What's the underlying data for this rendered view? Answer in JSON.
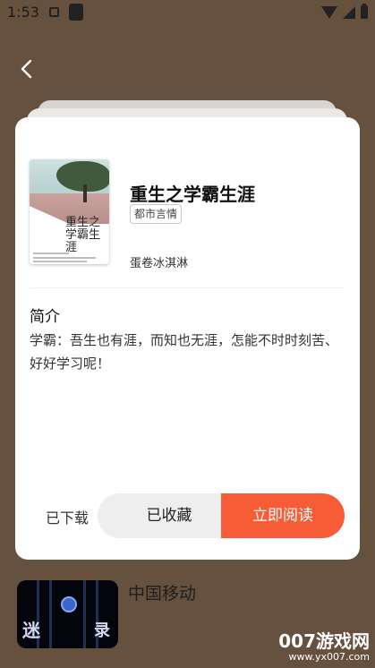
{
  "status_bar": {
    "time": "1:53"
  },
  "book": {
    "title": "重生之学霸生涯",
    "genre": "都市言情",
    "author": "蛋卷冰淇淋",
    "cover_title": "重生之学霸生涯",
    "intro_heading": "简介",
    "intro_text": "学霸：吾生也有涯，而知也无涯，怎能不时时刻苦、好好学习呢！"
  },
  "actions": {
    "downloaded_label": "已下载",
    "collect_label": "已收藏",
    "read_label": "立即阅读"
  },
  "ad": {
    "title": "中国移动"
  },
  "watermark": {
    "brand": "007游戏网",
    "url": "www.yx007.com"
  },
  "colors": {
    "background": "#66513e",
    "accent": "#f65c36",
    "card": "#ffffff"
  },
  "icons": {
    "back": "chevron-left-icon",
    "wifi": "wifi-icon",
    "signal": "signal-icon",
    "battery": "battery-icon"
  }
}
